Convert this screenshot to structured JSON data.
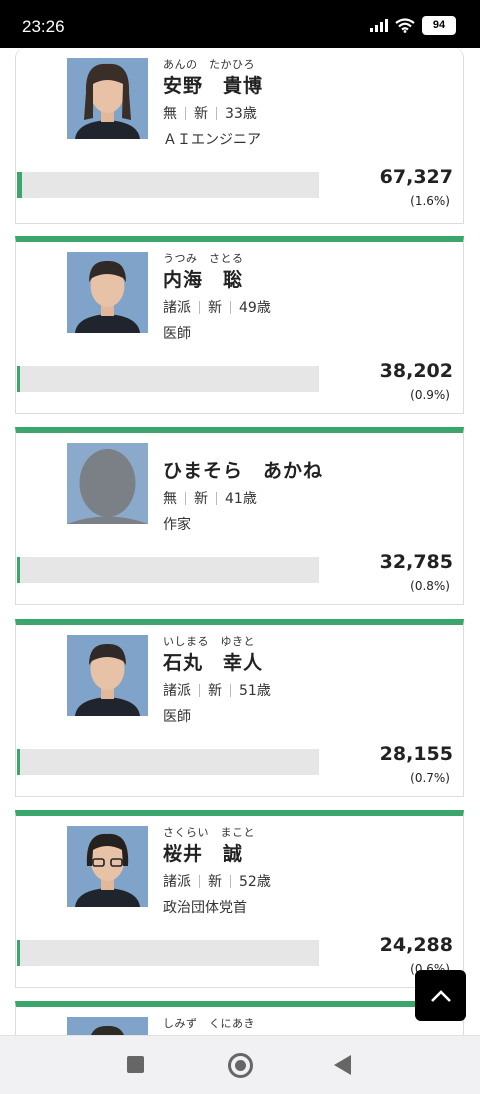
{
  "status_bar": {
    "time": "23:26",
    "battery": "94"
  },
  "accent_color": "#3aa66b",
  "candidates": [
    {
      "kana": "あんの　たかひろ",
      "name": "安野　貴博",
      "party": "無",
      "status": "新",
      "age": "33歳",
      "job": "ＡＩエンジニア",
      "votes": "67,327",
      "pct": "(1.6%)",
      "share": 0.016,
      "photo": "person-long-hair"
    },
    {
      "kana": "うつみ　さとる",
      "name": "内海　聡",
      "party": "諸派",
      "status": "新",
      "age": "49歳",
      "job": "医師",
      "votes": "38,202",
      "pct": "(0.9%)",
      "share": 0.009,
      "photo": "person-short-hair"
    },
    {
      "kana": "",
      "name": "ひまそら　あかね",
      "party": "無",
      "status": "新",
      "age": "41歳",
      "job": "作家",
      "votes": "32,785",
      "pct": "(0.8%)",
      "share": 0.008,
      "photo": "silhouette"
    },
    {
      "kana": "いしまる　ゆきと",
      "name": "石丸　幸人",
      "party": "諸派",
      "status": "新",
      "age": "51歳",
      "job": "医師",
      "votes": "28,155",
      "pct": "(0.7%)",
      "share": 0.007,
      "photo": "person-short-hair"
    },
    {
      "kana": "さくらい　まこと",
      "name": "桜井　誠",
      "party": "諸派",
      "status": "新",
      "age": "52歳",
      "job": "政治団体党首",
      "votes": "24,288",
      "pct": "(0.6%)",
      "share": 0.006,
      "photo": "person-glasses"
    },
    {
      "kana": "しみず　くにあき",
      "name": "",
      "party": "",
      "status": "",
      "age": "",
      "job": "",
      "votes": "",
      "pct": "",
      "share": 0,
      "photo": "person-short-hair"
    }
  ],
  "back_to_top_icon": "chevron-up-icon",
  "nav_icons": [
    "recents-icon",
    "home-icon",
    "back-icon"
  ]
}
